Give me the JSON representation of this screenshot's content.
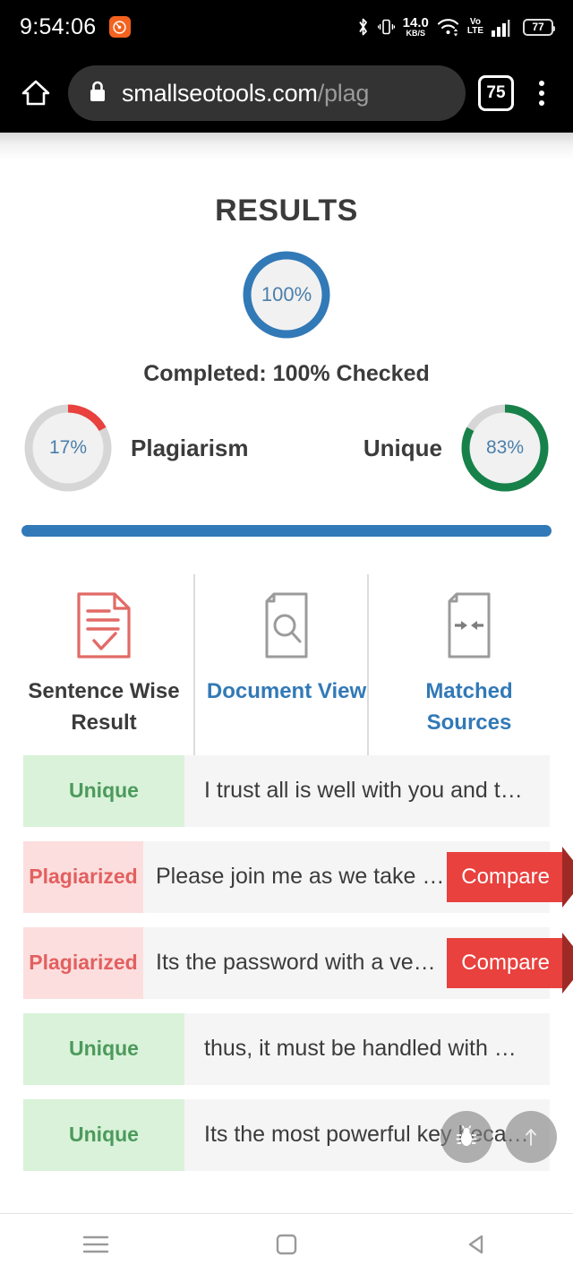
{
  "statusbar": {
    "clock": "9:54:06",
    "app_icon": "music-app-icon",
    "bluetooth_icon": "bluetooth-icon",
    "vibrate_icon": "vibrate-icon",
    "netspeed_value": "14.0",
    "netspeed_unit": "KB/S",
    "wifi_icon": "wifi-icon",
    "volte_line1": "Vo",
    "volte_line2": "LTE",
    "signal_icon": "signal-bars-icon",
    "battery_level": "77"
  },
  "browser": {
    "home_icon": "home-icon",
    "lock_icon": "lock-icon",
    "url_domain": "smallseotools.com",
    "url_path": "/plag",
    "tab_count": "75",
    "menu_icon": "overflow-menu-icon"
  },
  "results": {
    "title": "RESULTS",
    "main_gauge": {
      "value": "100%",
      "percent": 100,
      "color": "#3279b7"
    },
    "completed_text": "Completed: 100% Checked",
    "plagiarism": {
      "value": "17%",
      "percent": 17,
      "label": "Plagiarism",
      "color": "#e8413e"
    },
    "unique": {
      "value": "83%",
      "percent": 83,
      "label": "Unique",
      "color": "#17814a"
    },
    "progress_percent": 100,
    "progress_color": "#3279b7"
  },
  "tabs": [
    {
      "id": "sentence-wise-result",
      "label": "Sentence Wise Result",
      "icon": "document-check-icon",
      "active": true,
      "icon_color": "#e26a66",
      "label_color": "#3b3b3b"
    },
    {
      "id": "document-view",
      "label": "Document View",
      "icon": "document-search-icon",
      "active": false,
      "icon_color": "#9b9b9b",
      "label_color": "#3279b7"
    },
    {
      "id": "matched-sources",
      "label": "Matched Sources",
      "icon": "document-arrows-icon",
      "active": false,
      "icon_color": "#9b9b9b",
      "label_color": "#3279b7"
    }
  ],
  "sentence_rows": [
    {
      "status": "Unique",
      "type": "unique",
      "text": "I trust all is well with you and t…",
      "compare": null
    },
    {
      "status": "Plagiarized",
      "type": "plag",
      "text": "Please join me as we take …",
      "compare": "Compare"
    },
    {
      "status": "Plagiarized",
      "type": "plag",
      "text": "Its the password with a ve…",
      "compare": "Compare"
    },
    {
      "status": "Unique",
      "type": "unique",
      "text": "thus, it must be handled with …",
      "compare": null
    },
    {
      "status": "Unique",
      "type": "unique",
      "text": "Its the most powerful key beca…",
      "compare": null
    }
  ],
  "floating_buttons": [
    {
      "id": "report-bug",
      "icon": "bug-icon"
    },
    {
      "id": "scroll-top",
      "icon": "arrow-up-icon"
    }
  ],
  "navbar": [
    {
      "id": "recents",
      "icon": "recents-hamburger-icon"
    },
    {
      "id": "home",
      "icon": "home-square-icon"
    },
    {
      "id": "back",
      "icon": "back-triangle-icon"
    }
  ],
  "colors": {
    "accent_blue": "#3279b7",
    "plagiarized_red": "#e8413e",
    "unique_green": "#17814a",
    "row_bg": "#f5f5f5",
    "unique_badge_bg": "#d9f2d9",
    "plag_badge_bg": "#fcdede"
  }
}
